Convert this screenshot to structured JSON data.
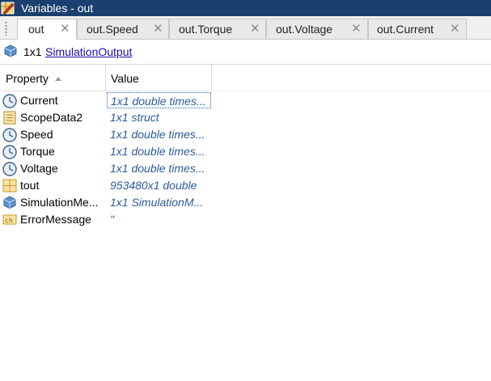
{
  "window": {
    "title": "Variables - out",
    "icon": "variables-editor-icon"
  },
  "tabs": [
    {
      "label": "out",
      "active": true
    },
    {
      "label": "out.Speed",
      "active": false
    },
    {
      "label": "out.Torque",
      "active": false
    },
    {
      "label": "out.Voltage",
      "active": false
    },
    {
      "label": "out.Current",
      "active": false
    }
  ],
  "close_glyph": "✕",
  "info": {
    "dims": "1x1",
    "class_link": "SimulationOutput",
    "icon": "struct-icon"
  },
  "table": {
    "headers": {
      "property": "Property",
      "value": "Value"
    },
    "sort": "ascending",
    "rows": [
      {
        "name": "Current",
        "value": "1x1 double times...",
        "icon": "timeseries-icon",
        "selected": true
      },
      {
        "name": "ScopeData2",
        "value": "1x1 struct",
        "icon": "struct-field-icon"
      },
      {
        "name": "Speed",
        "value": "1x1 double times...",
        "icon": "timeseries-icon"
      },
      {
        "name": "Torque",
        "value": "1x1 double times...",
        "icon": "timeseries-icon"
      },
      {
        "name": "Voltage",
        "value": "1x1 double times...",
        "icon": "timeseries-icon"
      },
      {
        "name": "tout",
        "value": "953480x1 double",
        "icon": "matrix-icon"
      },
      {
        "name": "SimulationMe...",
        "value": "1x1 SimulationM...",
        "icon": "object-icon"
      },
      {
        "name": "ErrorMessage",
        "value": "''",
        "icon": "char-icon"
      }
    ]
  },
  "colors": {
    "titlebar": "#19406e",
    "link": "#1a0dab",
    "value_text": "#2b5b9a",
    "selection_border": "#1f5fb3"
  }
}
